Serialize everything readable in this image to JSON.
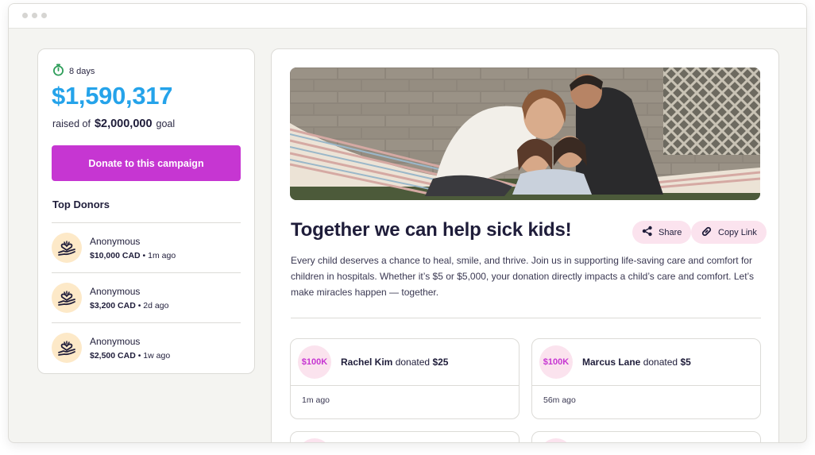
{
  "campaign": {
    "timer_icon": "stopwatch-icon",
    "days_left": "8 days",
    "raised_amount": "$1,590,317",
    "raised_prefix": "raised of",
    "goal_amount": "$2,000,000",
    "goal_suffix": "goal",
    "donate_label": "Donate to this campaign",
    "brand_color": "#c636d2",
    "amount_color": "#25a3ea"
  },
  "top_donors": {
    "title": "Top Donors",
    "items": [
      {
        "name": "Anonymous",
        "amount": "$10,000 CAD",
        "time": "1m ago",
        "icon": "heart-hand-icon"
      },
      {
        "name": "Anonymous",
        "amount": "$3,200 CAD",
        "time": "2d ago",
        "icon": "heart-hand-icon"
      },
      {
        "name": "Anonymous",
        "amount": "$2,500 CAD",
        "time": "1w ago",
        "icon": "heart-hand-icon"
      }
    ]
  },
  "main": {
    "title": "Together we can help sick kids!",
    "share_label": "Share",
    "copy_link_label": "Copy Link",
    "description": "Every child deserves a chance to heal, smile, and thrive. Join us in supporting life-saving care and comfort for children in hospitals. Whether it’s $5 or $5,000, your donation directly impacts a child’s care and comfort. Let’s make miracles happen — together.",
    "donations": [
      {
        "badge": "$100K",
        "name": "Rachel Kim",
        "verb": "donated",
        "amount": "$25",
        "time": "1m ago"
      },
      {
        "badge": "$100K",
        "name": "Marcus Lane",
        "verb": "donated",
        "amount": "$5",
        "time": "56m ago"
      }
    ]
  }
}
